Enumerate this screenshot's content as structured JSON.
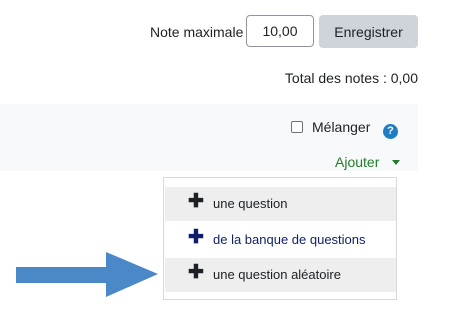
{
  "grade": {
    "label": "Note maximale",
    "value": "10,00",
    "save_label": "Enregistrer"
  },
  "total_grades": "Total des notes : 0,00",
  "shuffle": {
    "label": "Mélanger",
    "checked": false
  },
  "add": {
    "label": "Ajouter"
  },
  "add_menu": {
    "items": [
      {
        "label": "une question",
        "icon": "plus-icon",
        "color": "#1d2125"
      },
      {
        "label": "de la banque de questions",
        "icon": "plus-icon",
        "color": "#0f1e6b"
      },
      {
        "label": "une question aléatoire",
        "icon": "plus-icon",
        "color": "#1d2125"
      }
    ]
  },
  "colors": {
    "accent_green": "#1f7e2a",
    "help_blue": "#1f7ec3",
    "annotation_arrow": "#4a88c7"
  }
}
